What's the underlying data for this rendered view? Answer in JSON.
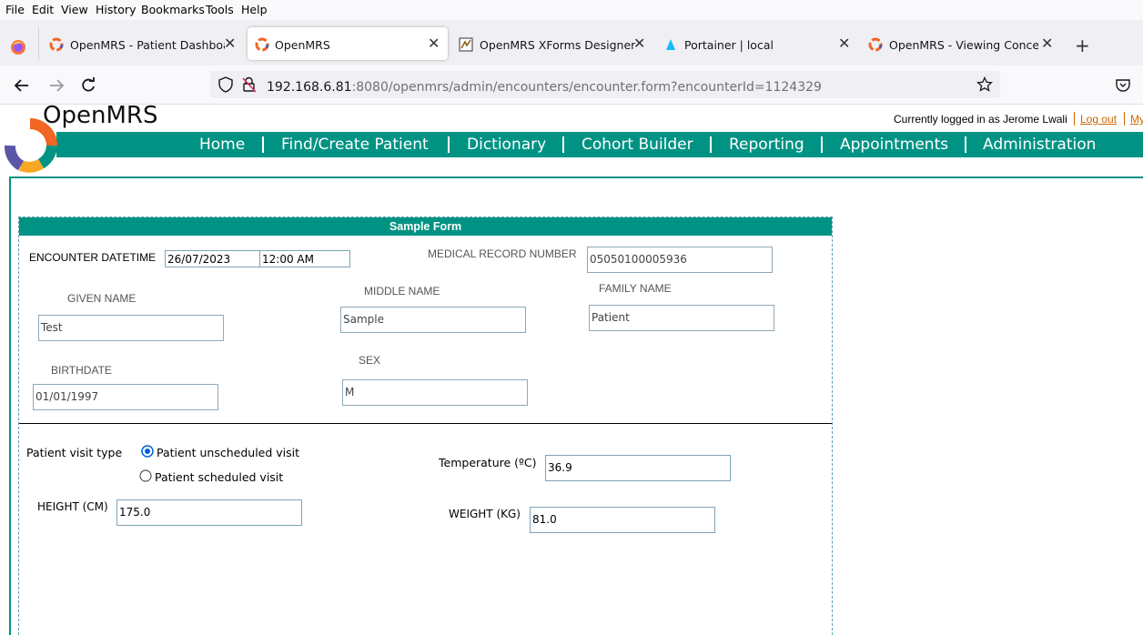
{
  "menu": [
    "File",
    "Edit",
    "View",
    "History",
    "Bookmarks",
    "Tools",
    "Help"
  ],
  "tabs": [
    {
      "label": "OpenMRS - Patient Dashboard",
      "icon": "openmrs-favicon-icon"
    },
    {
      "label": "OpenMRS",
      "icon": "openmrs-favicon-icon"
    },
    {
      "label": "OpenMRS XForms Designer",
      "icon": "xforms-favicon-icon"
    },
    {
      "label": "Portainer | local",
      "icon": "portainer-favicon-icon"
    },
    {
      "label": "OpenMRS - Viewing Concept P",
      "icon": "openmrs-favicon-icon"
    }
  ],
  "url": {
    "host": "192.168.6.81",
    "rest": ":8080/openmrs/admin/encounters/encounter.form?encounterId=1124329"
  },
  "header": {
    "logo_text": "OpenMRS",
    "logged_in_text": "Currently logged in as Jerome Lwali",
    "logout": "Log out",
    "my": "My"
  },
  "nav": [
    "Home",
    "Find/Create Patient",
    "Dictionary",
    "Cohort Builder",
    "Reporting",
    "Appointments",
    "Administration"
  ],
  "form": {
    "title": "Sample Form",
    "encounter_datetime_label": "ENCOUNTER DATETIME",
    "encounter_date": "26/07/2023",
    "encounter_time": "12:00 AM",
    "mrn_label": "MEDICAL RECORD NUMBER",
    "mrn": "05050100005936",
    "given_name_label": "GIVEN NAME",
    "given_name": "Test",
    "middle_name_label": "MIDDLE NAME",
    "middle_name": "Sample",
    "family_name_label": "FAMILY NAME",
    "family_name": "Patient",
    "birthdate_label": "BIRTHDATE",
    "birthdate": "01/01/1997",
    "sex_label": "SEX",
    "sex": "M",
    "visit_type_label": "Patient visit type",
    "visit_options": [
      "Patient unscheduled visit",
      "Patient scheduled visit"
    ],
    "temperature_label": "Temperature (ºC)",
    "temperature": "36.9",
    "height_label": "HEIGHT (CM)",
    "height": "175.0",
    "weight_label": "WEIGHT (KG)",
    "weight": "81.0"
  },
  "colors": {
    "teal": "#009384",
    "orange": "#f26522",
    "accent_link": "#cc6600",
    "radio_blue": "#0060df"
  }
}
